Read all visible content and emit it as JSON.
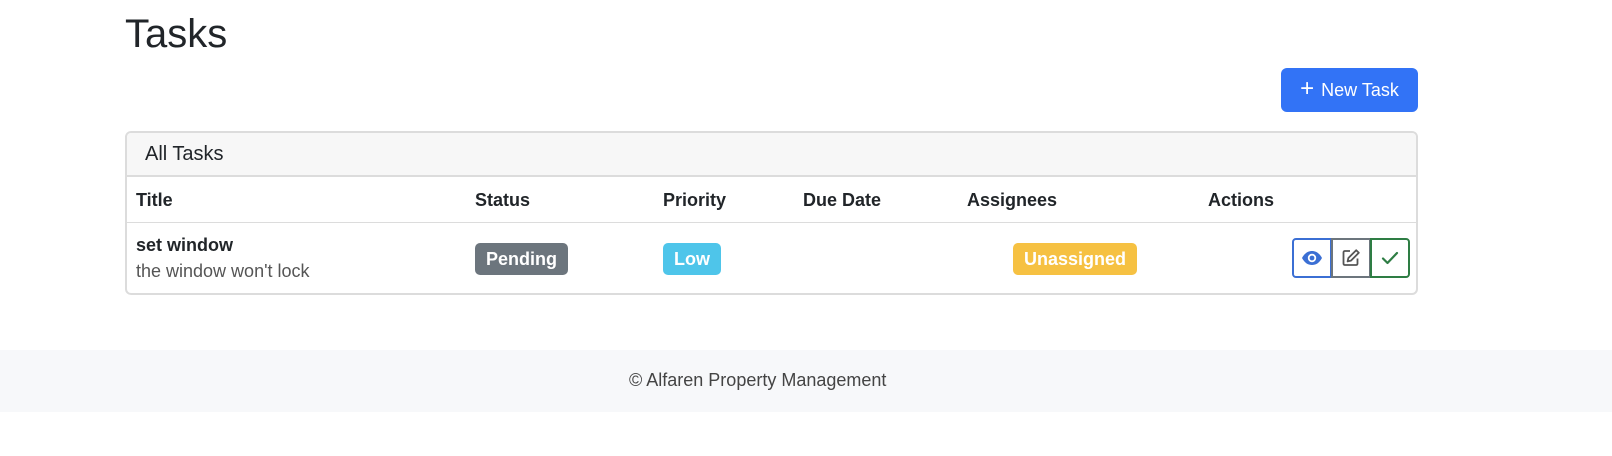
{
  "page": {
    "title": "Tasks"
  },
  "toolbar": {
    "new_task_icon": "+",
    "new_task_label": "New Task"
  },
  "card": {
    "header": "All Tasks",
    "columns": [
      "Title",
      "Status",
      "Priority",
      "Due Date",
      "Assignees",
      "Actions"
    ],
    "rows": [
      {
        "title": "set window",
        "description": "the window won't lock",
        "status": "Pending",
        "priority": "Low",
        "due_date": "",
        "assignees": "Unassigned",
        "actions": [
          "eye-icon",
          "edit-icon",
          "check-icon"
        ]
      }
    ]
  },
  "colors": {
    "primary": "#3273f6",
    "status_pending": "#6c757d",
    "priority_low": "#4ec5ea",
    "assignee_unassigned": "#f6c142",
    "complete": "#2e7d44"
  },
  "footer": {
    "text": "© Alfaren Property Management"
  }
}
